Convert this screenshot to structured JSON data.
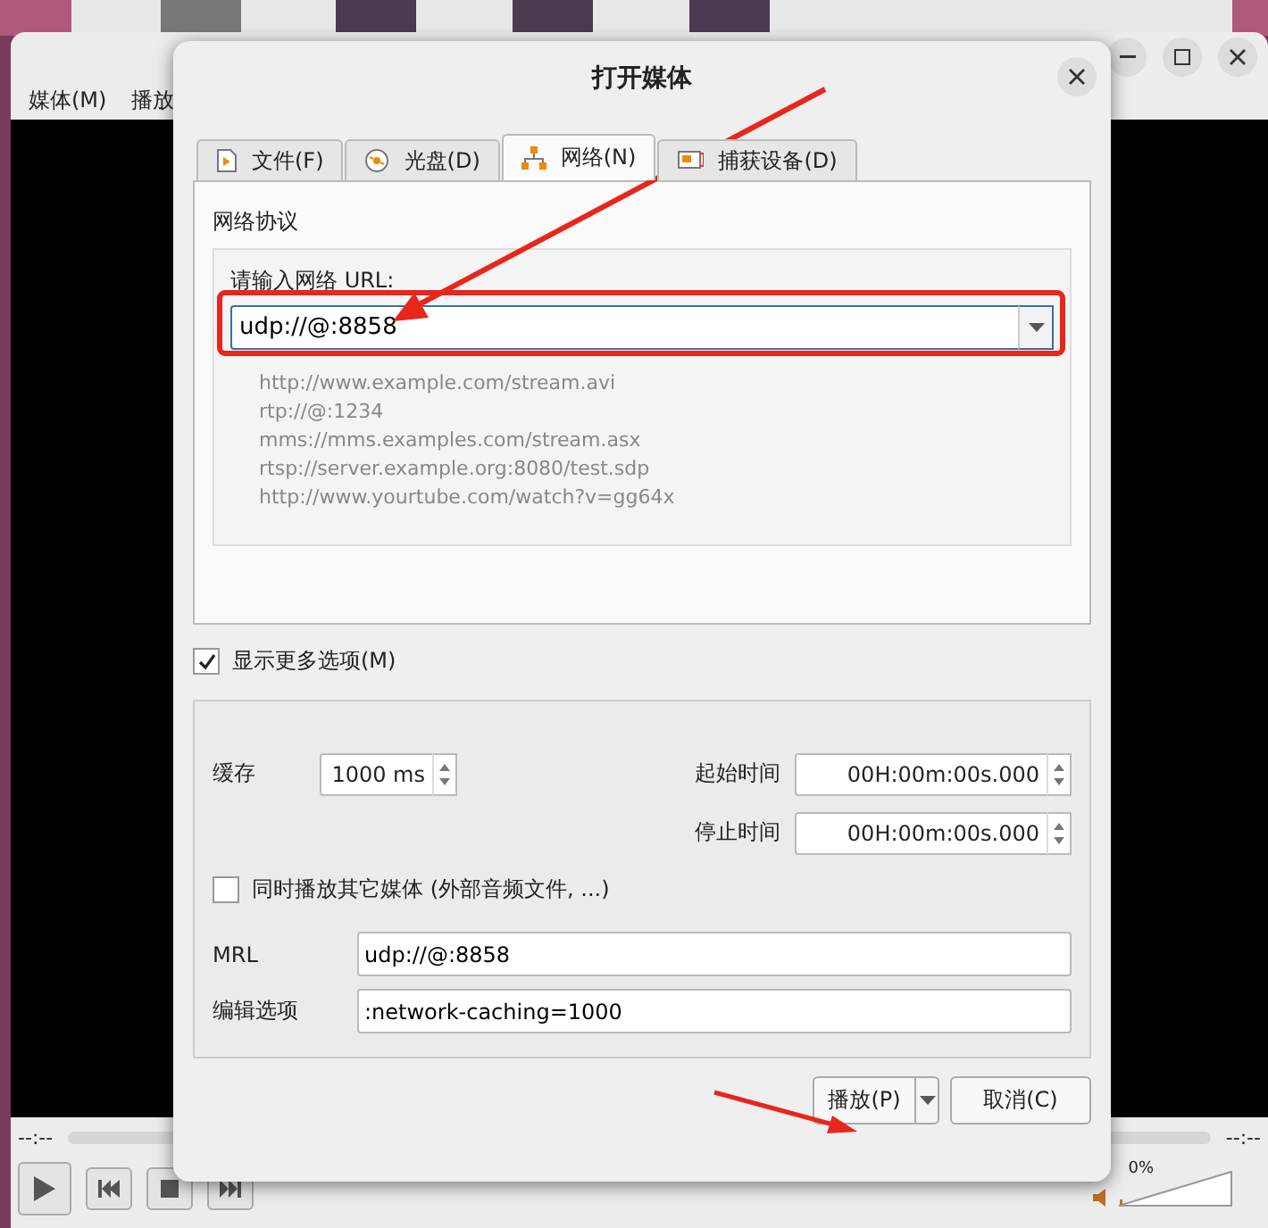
{
  "player": {
    "menu": [
      {
        "label": "媒体(M)"
      },
      {
        "label": "播放"
      }
    ],
    "elapsed": "--:--",
    "total": "--:--",
    "volume": {
      "reading": "0%",
      "level": 0
    }
  },
  "dialog": {
    "title": "打开媒体",
    "tabs": [
      {
        "label": "文件(F)",
        "kind": "file",
        "selected": false
      },
      {
        "label": "光盘(D)",
        "kind": "disc",
        "selected": false
      },
      {
        "label": "网络(N)",
        "kind": "network",
        "selected": true
      },
      {
        "label": "捕获设备(D)",
        "kind": "capture",
        "selected": false
      }
    ],
    "protocol_group": "网络协议",
    "url_label": "请输入网络 URL:",
    "url_value": "udp://@:8858",
    "examples": [
      "http://www.example.com/stream.avi",
      "rtp://@:1234",
      "mms://mms.examples.com/stream.asx",
      "rtsp://server.example.org:8080/test.sdp",
      "http://www.yourtube.com/watch?v=gg64x"
    ],
    "show_more": {
      "label": "显示更多选项(M)",
      "checked": true
    },
    "cache": {
      "label": "缓存",
      "value": "1000 ms"
    },
    "start_time": {
      "label": "起始时间",
      "value": "00H:00m:00s.000"
    },
    "stop_time": {
      "label": "停止时间",
      "value": "00H:00m:00s.000"
    },
    "play_another": {
      "label": "同时播放其它媒体 (外部音频文件, ...)",
      "checked": false
    },
    "mrl": {
      "label": "MRL",
      "value": "udp://@:8858"
    },
    "edit_options": {
      "label": "编辑选项",
      "value": ":network-caching=1000"
    },
    "buttons": [
      {
        "label": "播放(P)",
        "kind": "split"
      },
      {
        "label": "取消(C)",
        "kind": "plain"
      }
    ]
  }
}
